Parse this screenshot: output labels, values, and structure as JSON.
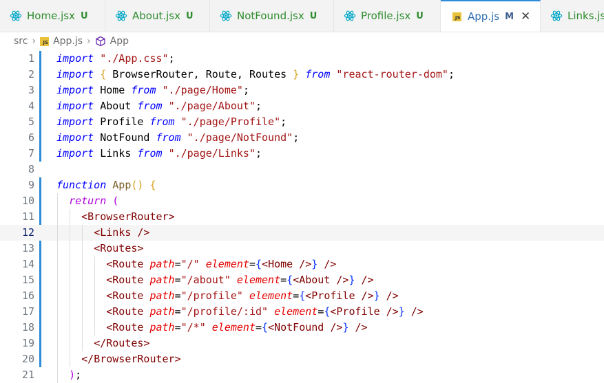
{
  "tabs": [
    {
      "name": "Home.jsx",
      "status": "U",
      "icon": "react-icon",
      "active": false
    },
    {
      "name": "About.jsx",
      "status": "U",
      "icon": "react-icon",
      "active": false
    },
    {
      "name": "NotFound.jsx",
      "status": "U",
      "icon": "react-icon",
      "active": false
    },
    {
      "name": "Profile.jsx",
      "status": "U",
      "icon": "react-icon",
      "active": false
    },
    {
      "name": "App.js",
      "status": "M",
      "icon": "js-file-icon",
      "active": true,
      "badge": "JS"
    },
    {
      "name": "Links.jsx",
      "status": "",
      "icon": "react-icon",
      "active": false
    }
  ],
  "breadcrumb": {
    "folder": "src",
    "file": "App.js",
    "symbol": "App",
    "file_badge": "JS"
  },
  "editor": {
    "current_line": 12,
    "lines": [
      {
        "n": "1",
        "tokens": [
          [
            "kw",
            "import"
          ],
          [
            "plain",
            " "
          ],
          [
            "str",
            "\"./App.css\""
          ],
          [
            "plain",
            ";"
          ]
        ]
      },
      {
        "n": "2",
        "tokens": [
          [
            "kw",
            "import"
          ],
          [
            "plain",
            " "
          ],
          [
            "b1",
            "{"
          ],
          [
            "plain",
            " BrowserRouter, Route, Routes "
          ],
          [
            "b1",
            "}"
          ],
          [
            "plain",
            " "
          ],
          [
            "kw2",
            "from"
          ],
          [
            "plain",
            " "
          ],
          [
            "str",
            "\"react-router-dom\""
          ],
          [
            "plain",
            ";"
          ]
        ]
      },
      {
        "n": "3",
        "tokens": [
          [
            "kw",
            "import"
          ],
          [
            "plain",
            " Home "
          ],
          [
            "kw2",
            "from"
          ],
          [
            "plain",
            " "
          ],
          [
            "str",
            "\"./page/Home\""
          ],
          [
            "plain",
            ";"
          ]
        ]
      },
      {
        "n": "4",
        "tokens": [
          [
            "kw",
            "import"
          ],
          [
            "plain",
            " About "
          ],
          [
            "kw2",
            "from"
          ],
          [
            "plain",
            " "
          ],
          [
            "str",
            "\"./page/About\""
          ],
          [
            "plain",
            ";"
          ]
        ]
      },
      {
        "n": "5",
        "tokens": [
          [
            "kw",
            "import"
          ],
          [
            "plain",
            " Profile "
          ],
          [
            "kw2",
            "from"
          ],
          [
            "plain",
            " "
          ],
          [
            "str",
            "\"./page/Profile\""
          ],
          [
            "plain",
            ";"
          ]
        ]
      },
      {
        "n": "6",
        "tokens": [
          [
            "kw",
            "import"
          ],
          [
            "plain",
            " NotFound "
          ],
          [
            "kw2",
            "from"
          ],
          [
            "plain",
            " "
          ],
          [
            "str",
            "\"./page/NotFound\""
          ],
          [
            "plain",
            ";"
          ]
        ]
      },
      {
        "n": "7",
        "tokens": [
          [
            "kw",
            "import"
          ],
          [
            "plain",
            " Links "
          ],
          [
            "kw2",
            "from"
          ],
          [
            "plain",
            " "
          ],
          [
            "str",
            "\"./page/Links\""
          ],
          [
            "plain",
            ";"
          ]
        ]
      },
      {
        "n": "8",
        "tokens": []
      },
      {
        "n": "9",
        "tokens": [
          [
            "kw",
            "function"
          ],
          [
            "plain",
            " "
          ],
          [
            "fn",
            "App"
          ],
          [
            "b1",
            "()"
          ],
          [
            "plain",
            " "
          ],
          [
            "b1",
            "{"
          ]
        ]
      },
      {
        "n": "10",
        "tokens": [
          [
            "plain",
            "  "
          ],
          [
            "ctrl",
            "return"
          ],
          [
            "plain",
            " "
          ],
          [
            "b2",
            "("
          ]
        ]
      },
      {
        "n": "11",
        "tokens": [
          [
            "plain",
            "    "
          ],
          [
            "ang",
            "<"
          ],
          [
            "tag",
            "BrowserRouter"
          ],
          [
            "ang",
            ">"
          ]
        ]
      },
      {
        "n": "12",
        "tokens": [
          [
            "plain",
            "      "
          ],
          [
            "ang",
            "<"
          ],
          [
            "tag",
            "Links"
          ],
          [
            "plain",
            " "
          ],
          [
            "ang",
            "/>"
          ]
        ]
      },
      {
        "n": "13",
        "tokens": [
          [
            "plain",
            "      "
          ],
          [
            "ang",
            "<"
          ],
          [
            "tag",
            "Routes"
          ],
          [
            "ang",
            ">"
          ]
        ]
      },
      {
        "n": "14",
        "tokens": [
          [
            "plain",
            "        "
          ],
          [
            "ang",
            "<"
          ],
          [
            "tag",
            "Route"
          ],
          [
            "plain",
            " "
          ],
          [
            "attr",
            "path"
          ],
          [
            "plain",
            "="
          ],
          [
            "str",
            "\"/\""
          ],
          [
            "plain",
            " "
          ],
          [
            "attr",
            "element"
          ],
          [
            "plain",
            "="
          ],
          [
            "b3",
            "{"
          ],
          [
            "ang",
            "<"
          ],
          [
            "tag",
            "Home"
          ],
          [
            "plain",
            " "
          ],
          [
            "ang",
            "/>"
          ],
          [
            "b3",
            "}"
          ],
          [
            "plain",
            " "
          ],
          [
            "ang",
            "/>"
          ]
        ]
      },
      {
        "n": "15",
        "tokens": [
          [
            "plain",
            "        "
          ],
          [
            "ang",
            "<"
          ],
          [
            "tag",
            "Route"
          ],
          [
            "plain",
            " "
          ],
          [
            "attr",
            "path"
          ],
          [
            "plain",
            "="
          ],
          [
            "str",
            "\"/about\""
          ],
          [
            "plain",
            " "
          ],
          [
            "attr",
            "element"
          ],
          [
            "plain",
            "="
          ],
          [
            "b3",
            "{"
          ],
          [
            "ang",
            "<"
          ],
          [
            "tag",
            "About"
          ],
          [
            "plain",
            " "
          ],
          [
            "ang",
            "/>"
          ],
          [
            "b3",
            "}"
          ],
          [
            "plain",
            " "
          ],
          [
            "ang",
            "/>"
          ]
        ]
      },
      {
        "n": "16",
        "tokens": [
          [
            "plain",
            "        "
          ],
          [
            "ang",
            "<"
          ],
          [
            "tag",
            "Route"
          ],
          [
            "plain",
            " "
          ],
          [
            "attr",
            "path"
          ],
          [
            "plain",
            "="
          ],
          [
            "str",
            "\"/profile\""
          ],
          [
            "plain",
            " "
          ],
          [
            "attr",
            "element"
          ],
          [
            "plain",
            "="
          ],
          [
            "b3",
            "{"
          ],
          [
            "ang",
            "<"
          ],
          [
            "tag",
            "Profile"
          ],
          [
            "plain",
            " "
          ],
          [
            "ang",
            "/>"
          ],
          [
            "b3",
            "}"
          ],
          [
            "plain",
            " "
          ],
          [
            "ang",
            "/>"
          ]
        ]
      },
      {
        "n": "17",
        "tokens": [
          [
            "plain",
            "        "
          ],
          [
            "ang",
            "<"
          ],
          [
            "tag",
            "Route"
          ],
          [
            "plain",
            " "
          ],
          [
            "attr",
            "path"
          ],
          [
            "plain",
            "="
          ],
          [
            "str",
            "\"/profile/:id\""
          ],
          [
            "plain",
            " "
          ],
          [
            "attr",
            "element"
          ],
          [
            "plain",
            "="
          ],
          [
            "b3",
            "{"
          ],
          [
            "ang",
            "<"
          ],
          [
            "tag",
            "Profile"
          ],
          [
            "plain",
            " "
          ],
          [
            "ang",
            "/>"
          ],
          [
            "b3",
            "}"
          ],
          [
            "plain",
            " "
          ],
          [
            "ang",
            "/>"
          ]
        ]
      },
      {
        "n": "18",
        "tokens": [
          [
            "plain",
            "        "
          ],
          [
            "ang",
            "<"
          ],
          [
            "tag",
            "Route"
          ],
          [
            "plain",
            " "
          ],
          [
            "attr",
            "path"
          ],
          [
            "plain",
            "="
          ],
          [
            "str",
            "\"/*\""
          ],
          [
            "plain",
            " "
          ],
          [
            "attr",
            "element"
          ],
          [
            "plain",
            "="
          ],
          [
            "b3",
            "{"
          ],
          [
            "ang",
            "<"
          ],
          [
            "tag",
            "NotFound"
          ],
          [
            "plain",
            " "
          ],
          [
            "ang",
            "/>"
          ],
          [
            "b3",
            "}"
          ],
          [
            "plain",
            " "
          ],
          [
            "ang",
            "/>"
          ]
        ]
      },
      {
        "n": "19",
        "tokens": [
          [
            "plain",
            "      "
          ],
          [
            "ang",
            "</"
          ],
          [
            "tag",
            "Routes"
          ],
          [
            "ang",
            ">"
          ]
        ]
      },
      {
        "n": "20",
        "tokens": [
          [
            "plain",
            "    "
          ],
          [
            "ang",
            "</"
          ],
          [
            "tag",
            "BrowserRouter"
          ],
          [
            "ang",
            ">"
          ]
        ]
      },
      {
        "n": "21",
        "tokens": [
          [
            "plain",
            "  "
          ],
          [
            "b2",
            ")"
          ],
          [
            "plain",
            ";"
          ]
        ]
      }
    ]
  }
}
